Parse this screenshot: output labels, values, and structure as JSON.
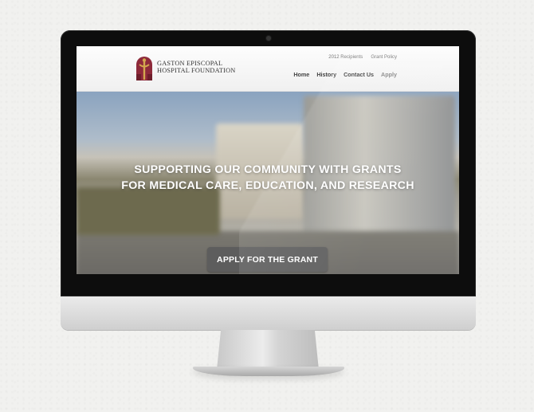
{
  "header": {
    "logo_line1": "Gaston Episcopal",
    "logo_line2": "Hospital Foundation",
    "top_links": [
      "2012 Recipients",
      "Grant Policy"
    ],
    "nav": [
      "Home",
      "History",
      "Contact Us",
      "Apply"
    ]
  },
  "hero": {
    "title_line1": "Supporting our community with grants",
    "title_line2": "for medical care, education, and research",
    "cta_label": "Apply for the grant"
  },
  "colors": {
    "logo_maroon": "#8e2a3a",
    "logo_gold": "#d3a84e",
    "cta_bg": "#5d5d5d"
  },
  "icons": {
    "logo": "cross-figure-arch-logo",
    "camera": "webcam-dot"
  }
}
